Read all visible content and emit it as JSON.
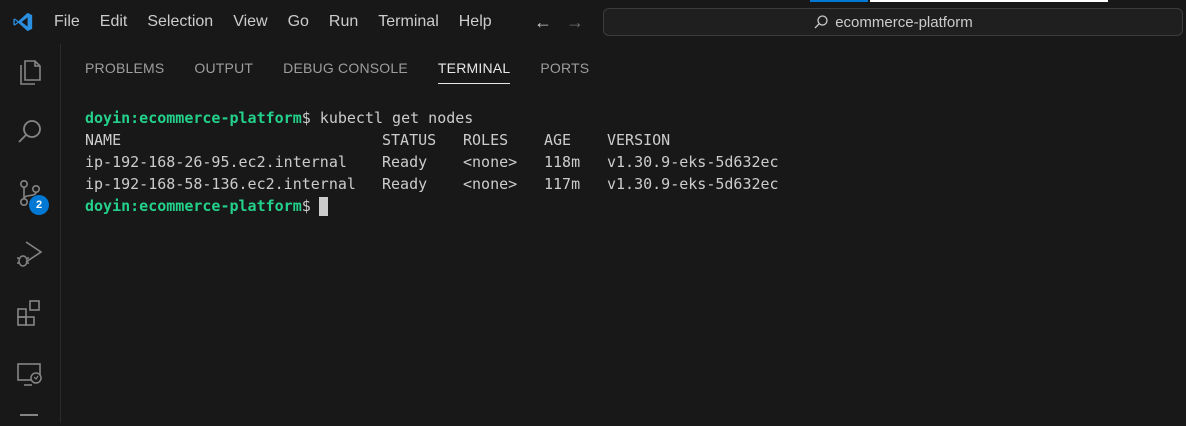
{
  "menu": [
    "File",
    "Edit",
    "Selection",
    "View",
    "Go",
    "Run",
    "Terminal",
    "Help"
  ],
  "search": {
    "text": "ecommerce-platform"
  },
  "activity": {
    "scm_badge": "2"
  },
  "panel": {
    "tabs": [
      "PROBLEMS",
      "OUTPUT",
      "DEBUG CONSOLE",
      "TERMINAL",
      "PORTS"
    ],
    "active_tab": "TERMINAL"
  },
  "terminal": {
    "prompt": "doyin:ecommerce-platform",
    "command": "$ kubectl get nodes",
    "final_prompt_suffix": "$",
    "headers": [
      "NAME",
      "STATUS",
      "ROLES",
      "AGE",
      "VERSION"
    ],
    "rows": [
      [
        "ip-192-168-26-95.ec2.internal",
        "Ready",
        "<none>",
        "118m",
        "v1.30.9-eks-5d632ec"
      ],
      [
        "ip-192-168-58-136.ec2.internal",
        "Ready",
        "<none>",
        "117m",
        "v1.30.9-eks-5d632ec"
      ]
    ]
  },
  "colors": {
    "accent": "#0078d4",
    "prompt_green": "#23d18b",
    "background": "#181818"
  }
}
